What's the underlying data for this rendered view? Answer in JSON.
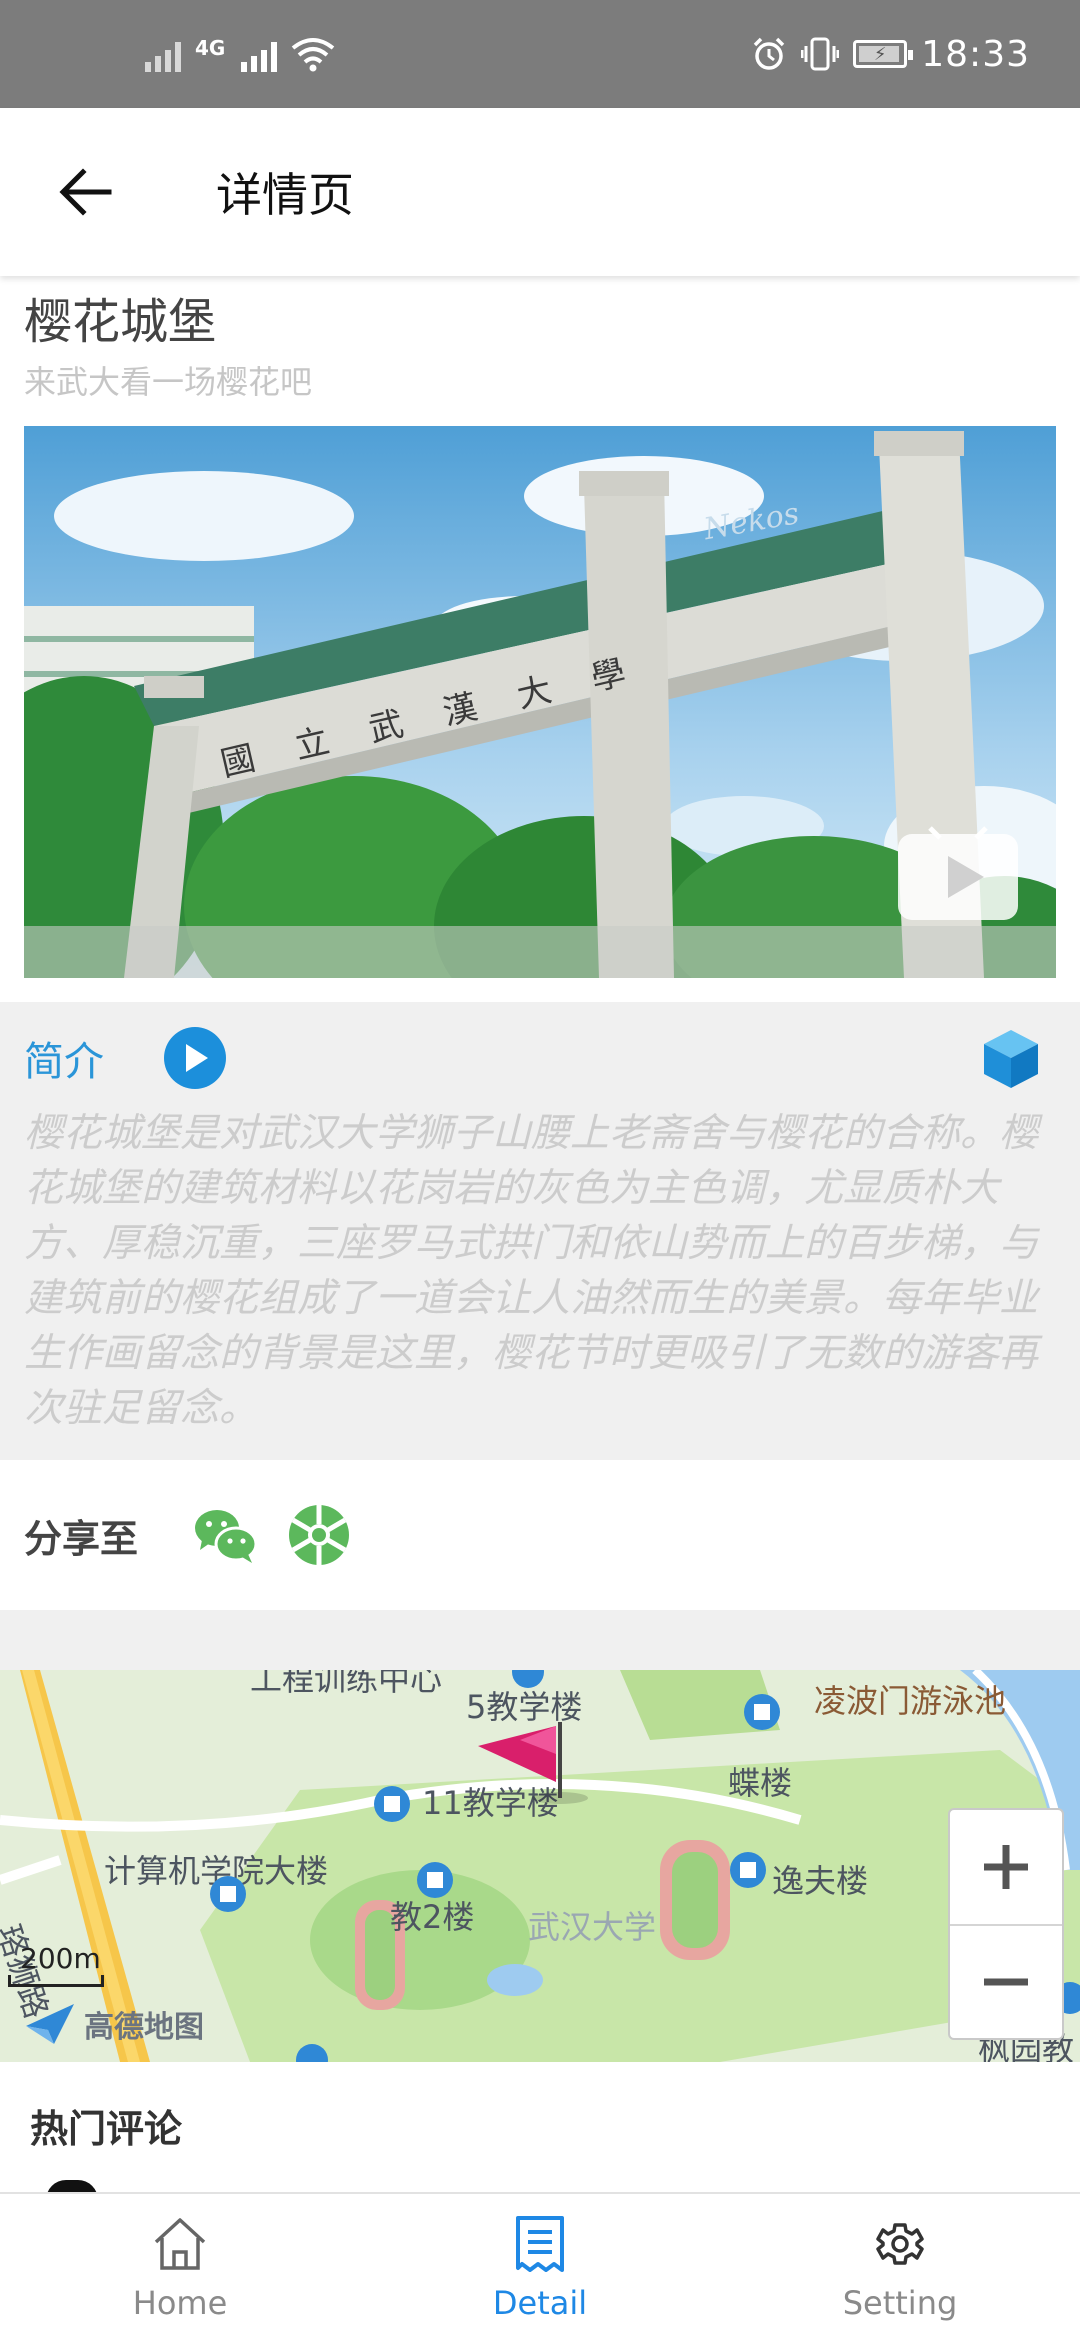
{
  "status_bar": {
    "time": "18:33",
    "net_tag": "4G"
  },
  "app_bar": {
    "title": "详情页"
  },
  "place": {
    "title": "樱花城堡",
    "subtitle": "来武大看一场樱花吧",
    "gate_inscription": "國立武漢大學",
    "watermark": "Nekos"
  },
  "intro": {
    "label": "简介",
    "text": "樱花城堡是对武汉大学狮子山腰上老斋舍与樱花的合称。樱花城堡的建筑材料以花岗岩的灰色为主色调，尤显质朴大方、厚稳沉重，三座罗马式拱门和依山势而上的百步梯，与建筑前的樱花组成了一道会让人油然而生的美景。每年毕业生作画留念的背景是这里，樱花节时更吸引了无数的游客再次驻足留念。"
  },
  "share": {
    "label": "分享至",
    "icons": [
      "wechat-icon",
      "moments-icon"
    ]
  },
  "map": {
    "labels": {
      "top_cut": "工程训练中心",
      "jiao5": "5教学楼",
      "lingbomen": "凌波门游泳池",
      "dielou": "蝶楼",
      "jiao11": "11教学楼",
      "luoshi": "珞狮路",
      "cs_building": "计算机学院大楼",
      "yifu": "逸夫楼",
      "jiao2": "教2楼",
      "whu": "武汉大学",
      "fengyuan": "枫园教"
    },
    "scale": "200m",
    "provider": "高德地图",
    "zoom_in": "+",
    "zoom_out": "−"
  },
  "comments": {
    "title": "热门评论"
  },
  "bottom_nav": {
    "items": [
      {
        "label": "Home",
        "icon": "home-icon",
        "active": false
      },
      {
        "label": "Detail",
        "icon": "detail-icon",
        "active": true
      },
      {
        "label": "Setting",
        "icon": "gear-icon",
        "active": false
      }
    ]
  },
  "colors": {
    "status_bar": "#7c7c7c",
    "accent_blue": "#1e88e5",
    "intro_label": "#2a95d8",
    "panel_bg": "#f0f0f0",
    "wechat_green": "#5cb85c"
  }
}
